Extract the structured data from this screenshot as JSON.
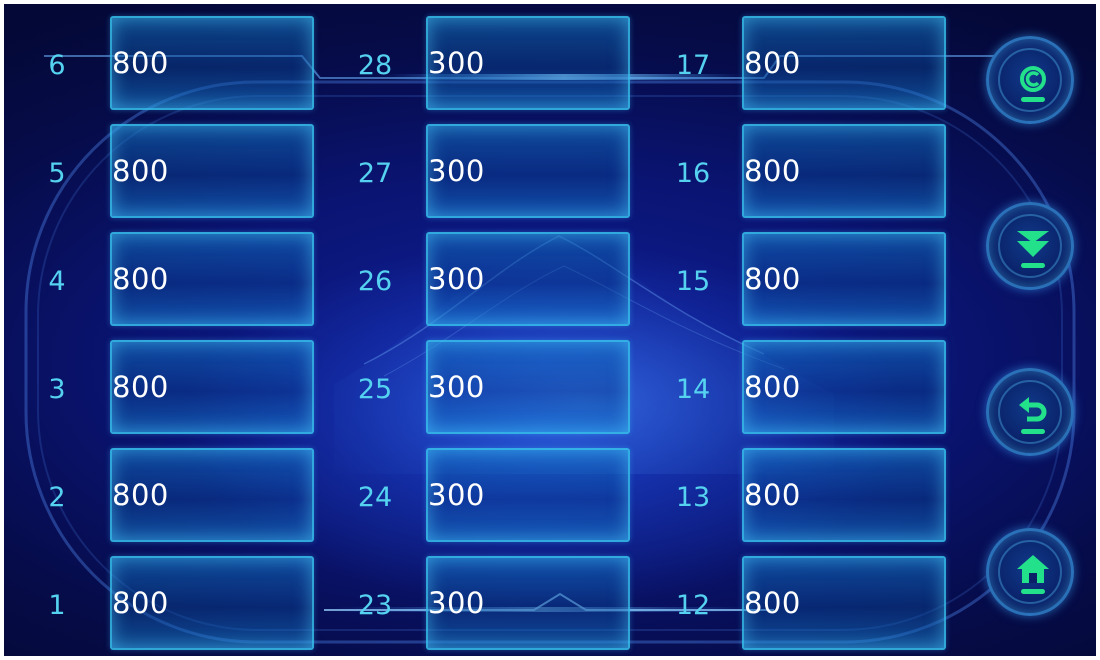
{
  "colors": {
    "label": "#55d2f0",
    "value": "#ffffff",
    "icon_green": "#23e08a",
    "cell_border": "#3cc8f0"
  },
  "columns": [
    {
      "rows": [
        {
          "label": "6",
          "value": "800"
        },
        {
          "label": "5",
          "value": "800"
        },
        {
          "label": "4",
          "value": "800"
        },
        {
          "label": "3",
          "value": "800"
        },
        {
          "label": "2",
          "value": "800"
        },
        {
          "label": "1",
          "value": "800"
        }
      ]
    },
    {
      "rows": [
        {
          "label": "28",
          "value": "300"
        },
        {
          "label": "27",
          "value": "300"
        },
        {
          "label": "26",
          "value": "300"
        },
        {
          "label": "25",
          "value": "300"
        },
        {
          "label": "24",
          "value": "300"
        },
        {
          "label": "23",
          "value": "300"
        }
      ]
    },
    {
      "rows": [
        {
          "label": "17",
          "value": "800"
        },
        {
          "label": "16",
          "value": "800"
        },
        {
          "label": "15",
          "value": "800"
        },
        {
          "label": "14",
          "value": "800"
        },
        {
          "label": "13",
          "value": "800"
        },
        {
          "label": "12",
          "value": "800"
        }
      ]
    }
  ],
  "side_buttons": [
    {
      "icon": "clear-c-icon"
    },
    {
      "icon": "download-arrow-icon"
    },
    {
      "icon": "return-arrow-icon"
    },
    {
      "icon": "home-icon"
    }
  ]
}
